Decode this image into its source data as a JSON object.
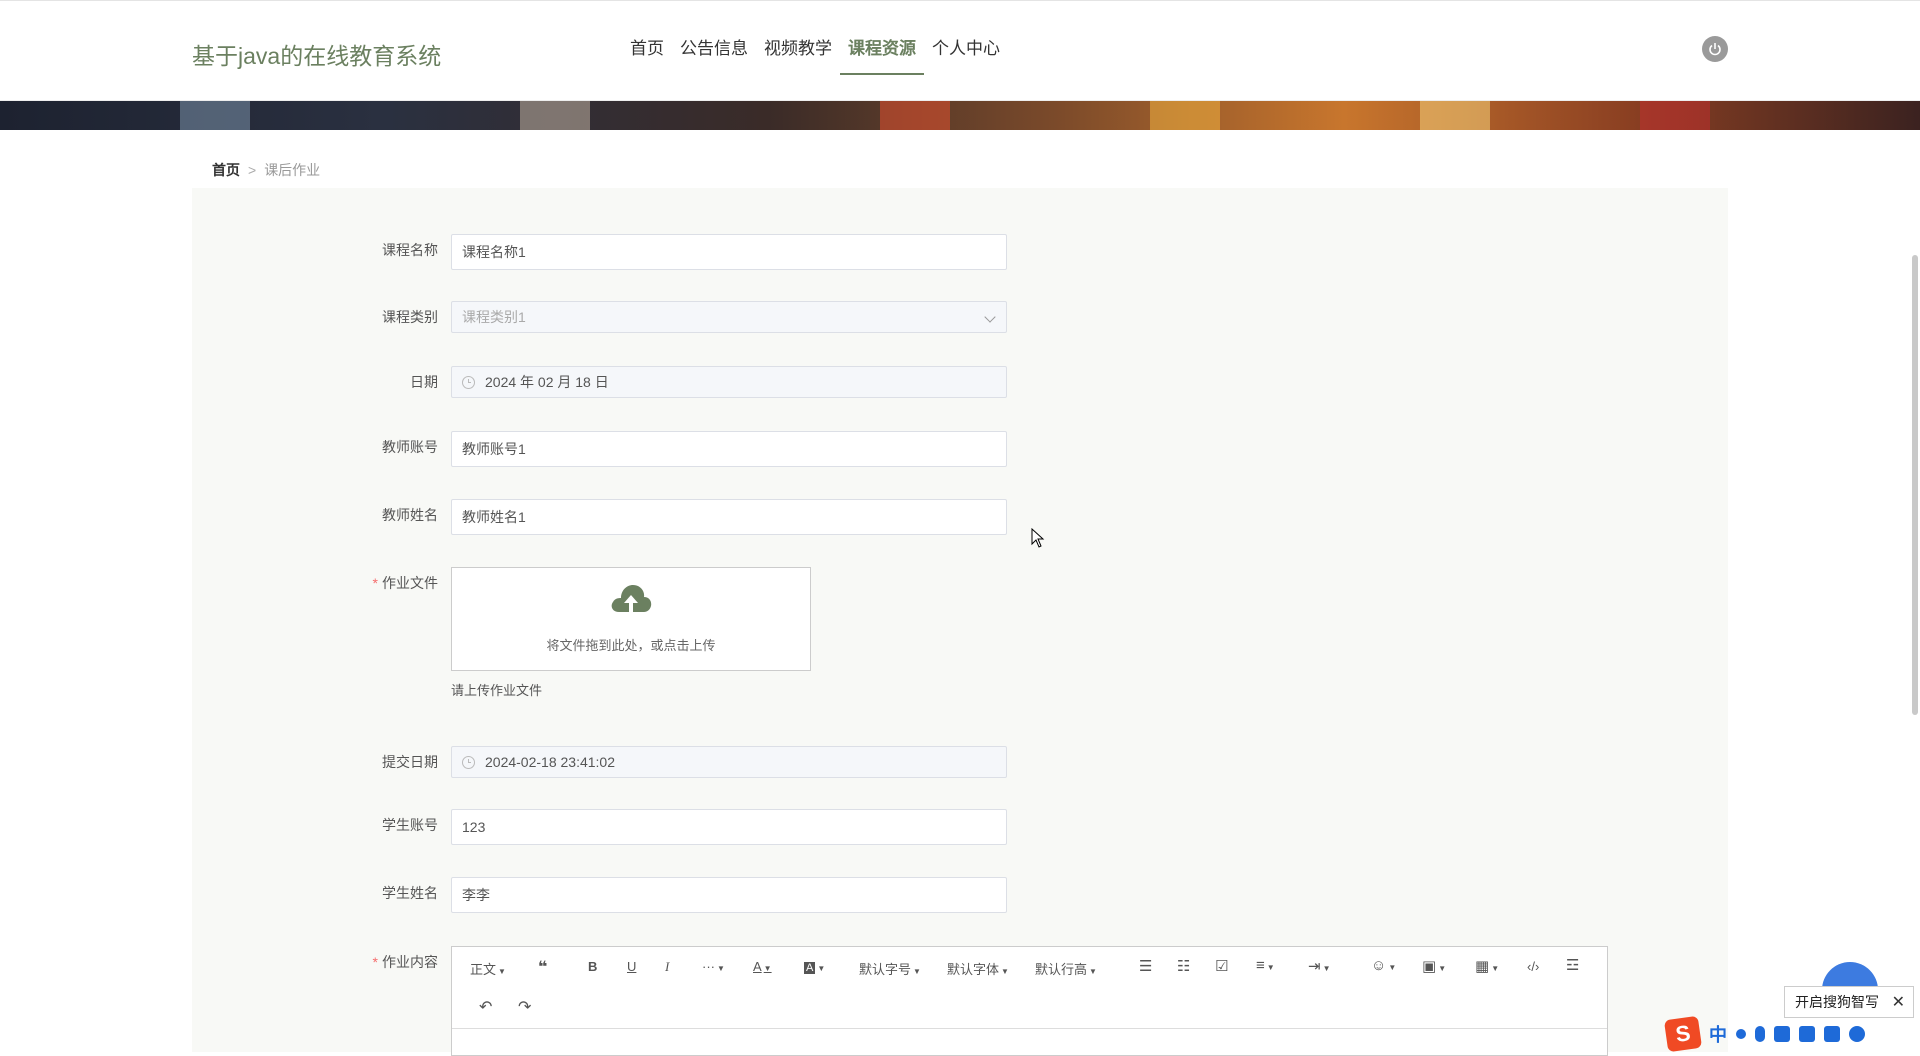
{
  "header": {
    "site_title": "基于java的在线教育系统",
    "nav": [
      {
        "label": "首页",
        "active": false
      },
      {
        "label": "公告信息",
        "active": false
      },
      {
        "label": "视频教学",
        "active": false
      },
      {
        "label": "课程资源",
        "active": true
      },
      {
        "label": "个人中心",
        "active": false
      }
    ],
    "power_icon": "power-icon"
  },
  "breadcrumb": {
    "home": "首页",
    "separator": ">",
    "current": "课后作业"
  },
  "form": {
    "course_name": {
      "label": "课程名称",
      "value": "课程名称1"
    },
    "course_type": {
      "label": "课程类别",
      "value": "课程类别1"
    },
    "date": {
      "label": "日期",
      "value": "2024 年 02 月 18 日"
    },
    "teacher_account": {
      "label": "教师账号",
      "value": "教师账号1"
    },
    "teacher_name": {
      "label": "教师姓名",
      "value": "教师姓名1"
    },
    "homework_file": {
      "label": "作业文件",
      "required_mark": "*",
      "upload_text": "将文件拖到此处，或点击上传",
      "tip": "请上传作业文件"
    },
    "submit_date": {
      "label": "提交日期",
      "value": "2024-02-18 23:41:02"
    },
    "student_account": {
      "label": "学生账号",
      "value": "123"
    },
    "student_name": {
      "label": "学生姓名",
      "value": "李李"
    },
    "homework_content": {
      "label": "作业内容",
      "required_mark": "*"
    }
  },
  "editor_toolbar": {
    "paragraph": "正文",
    "font_size": "默认字号",
    "font_family": "默认字体",
    "line_height": "默认行高",
    "more": "···",
    "font_color": "A",
    "bg_color": "A"
  },
  "overlay": {
    "sogou_tip": "开启搜狗智写",
    "close": "✕",
    "ime_lang": "中",
    "ime_logo": "S"
  },
  "colors": {
    "accent": "#6b8060",
    "required": "#f56c6c",
    "ime_blue": "#1e6ad8"
  }
}
